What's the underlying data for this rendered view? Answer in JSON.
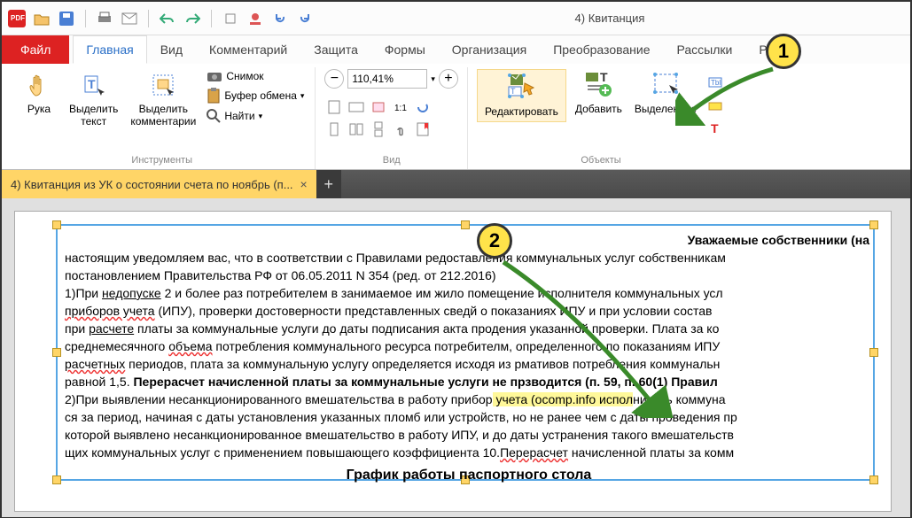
{
  "window_title": "4) Квитанция",
  "tabs": {
    "file": "Файл",
    "home": "Главная",
    "view": "Вид",
    "comment": "Комментарий",
    "protect": "Защита",
    "forms": "Формы",
    "organize": "Организация",
    "convert": "Преобразование",
    "mail": "Рассылки",
    "rece": "Реце"
  },
  "groups": {
    "tools": "Инструменты",
    "view": "Вид",
    "objects": "Объекты"
  },
  "buttons": {
    "hand": "Рука",
    "select_text": "Выделить\nтекст",
    "select_comments": "Выделить\nкомментарии",
    "snapshot": "Снимок",
    "clipboard": "Буфер обмена",
    "find": "Найти",
    "edit": "Редактировать",
    "add": "Добавить",
    "selected": "Выделенное"
  },
  "zoom": "110,41%",
  "doc_tab": "4) Квитанция из УК о состоянии счета по ноябрь (п...",
  "callouts": {
    "one": "1",
    "two": "2"
  },
  "doc": {
    "header": "Уважаемые собственники (на",
    "l1a": "настоящим уведомляем вас, что в соответствии с Правилами ",
    "l1b": "редоставления коммунальных услуг собственникам",
    "l2": "постановлением Правительства РФ от 06.05.2011 N 354 (ред. от 2",
    "l2b": "12.2016)",
    "l3a": "1)При ",
    "l3u": "недопуске",
    "l3b": " 2 и более раз потребителем в занимаемое им жило",
    "l3c": " помещение исполнителя коммунальных усл",
    "l4a": "приборов учета",
    "l4b": " (ИПУ), проверки достоверности представленных свед",
    "l4c": "й о показаниях ИПУ и при условии состав",
    "l5a": "при ",
    "l5u": "расчете",
    "l5b": " платы за коммунальные услуги до даты подписания акта про",
    "l5c": "дения указанной проверки. Плата за ко",
    "l6a": "среднемесячного ",
    "l6u": "объема",
    "l6b": " потребления коммунального ресурса потребител",
    "l6c": "м, определенного по показаниям ИПУ ",
    "l7a": "расчетных",
    "l7b": " периодов, плата за коммунальную услугу определяется исходя из ",
    "l7c": "рмативов потребления коммунальн",
    "l8a": "равной 1,5. ",
    "l8bold": "Перерасчет начисленной платы за коммунальные услуги не пр",
    "l8b": "зводится (п. 59, п. 60(1) Правил",
    "l9a": "2)При выявлении несанкционированного вмешательства в работу прибор",
    "l9hl": " учета (ocomp.info испол",
    "l9b": "нитель коммуна",
    "l10": "ся за период, начиная с даты установления указанных пломб или устройств, но не ранее чем с даты проведения пр",
    "l11": "которой выявлено несанкционированное вмешательство в работу ИПУ, и до даты устранения такого вмешательств",
    "l12a": "щих коммунальных услуг с применением повышающего коэффициента 10.",
    "l12u": "Перерасчет",
    "l12b": " начисленной платы за комм",
    "h2": "График работы паспортного стола"
  }
}
